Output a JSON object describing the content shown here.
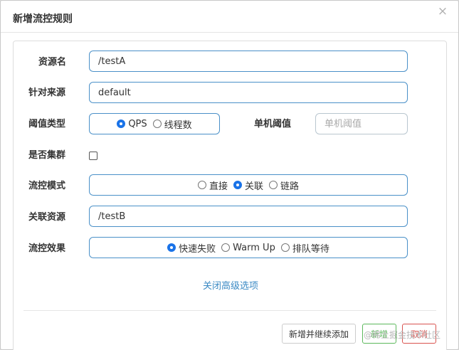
{
  "dialog": {
    "title": "新增流控规则",
    "close_icon": "×"
  },
  "form": {
    "resource": {
      "label": "资源名",
      "value": "/testA"
    },
    "limit_app": {
      "label": "针对来源",
      "value": "default"
    },
    "grade": {
      "label": "阈值类型",
      "options": [
        "QPS",
        "线程数"
      ],
      "selected": "QPS"
    },
    "threshold": {
      "label": "单机阈值",
      "value": "",
      "placeholder": "单机阈值"
    },
    "cluster": {
      "label": "是否集群",
      "checked": false
    },
    "strategy": {
      "label": "流控模式",
      "options": [
        "直接",
        "关联",
        "链路"
      ],
      "selected": "关联"
    },
    "ref_resource": {
      "label": "关联资源",
      "value": "/testB"
    },
    "control_behavior": {
      "label": "流控效果",
      "options": [
        "快速失败",
        "Warm Up",
        "排队等待"
      ],
      "selected": "快速失败"
    },
    "advanced_toggle": "关闭高级选项"
  },
  "footer": {
    "add_continue_label": "新增并继续添加",
    "add_label": "新增",
    "cancel_label": "取消"
  },
  "watermark": "@稀土掘金技术社区"
}
